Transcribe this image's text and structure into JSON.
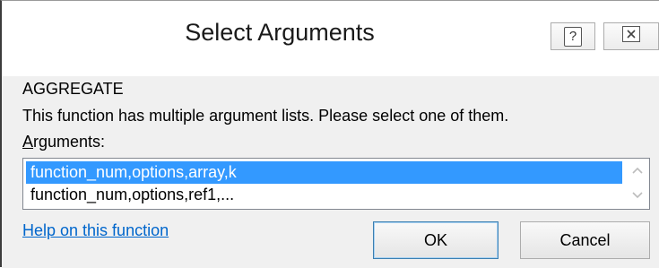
{
  "dialog": {
    "title": "Select Arguments",
    "help_glyph": "?",
    "close_icon": "close-icon"
  },
  "function_name": "AGGREGATE",
  "description": "This function has multiple argument lists.  Please select one of them.",
  "arguments_label": {
    "accel": "A",
    "rest": "rguments:"
  },
  "argument_lists": [
    {
      "label": "function_num,options,array,k",
      "selected": true
    },
    {
      "label": "function_num,options,ref1,...",
      "selected": false
    }
  ],
  "help_link": "Help on this function",
  "buttons": {
    "ok": "OK",
    "cancel": "Cancel"
  },
  "colors": {
    "selection": "#3399ff",
    "link": "#0066cc"
  }
}
